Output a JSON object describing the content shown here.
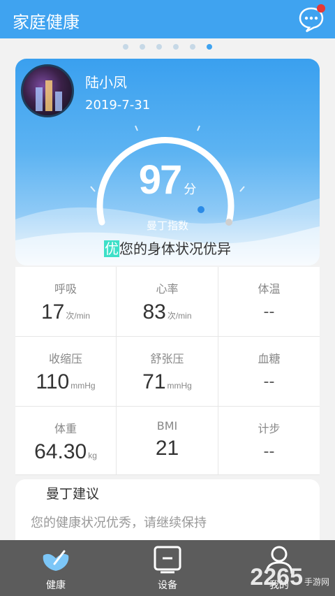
{
  "header": {
    "title": "家庭健康",
    "chat_icon": "chat-bubble-icon"
  },
  "carousel": {
    "count": 6,
    "active_index": 5
  },
  "profile": {
    "name": "陆小凤",
    "date": "2019-7-31",
    "icons": [
      "share-icon",
      "mail-icon",
      "warning-icon"
    ]
  },
  "score": {
    "value": "97",
    "unit": "分",
    "label": "曼丁指数",
    "grade": "优",
    "status_text": "您的身体状况优异"
  },
  "metrics": [
    {
      "label": "呼吸",
      "value": "17",
      "unit": "次/min"
    },
    {
      "label": "心率",
      "value": "83",
      "unit": "次/min"
    },
    {
      "label": "体温",
      "value": "--",
      "unit": ""
    },
    {
      "label": "收缩压",
      "value": "110",
      "unit": "mmHg"
    },
    {
      "label": "舒张压",
      "value": "71",
      "unit": "mmHg"
    },
    {
      "label": "血糖",
      "value": "--",
      "unit": ""
    },
    {
      "label": "体重",
      "value": "64.30",
      "unit": "kg"
    },
    {
      "label": "BMI",
      "value": "21",
      "unit": ""
    },
    {
      "label": "计步",
      "value": "--",
      "unit": ""
    }
  ],
  "advice": {
    "heading": "曼丁建议",
    "text": "您的健康状况优秀，请继续保持"
  },
  "nav": [
    {
      "label": "健康",
      "icon": "heart-hand-icon"
    },
    {
      "label": "设备",
      "icon": "device-icon"
    },
    {
      "label": "我的",
      "icon": "user-icon"
    }
  ],
  "watermark": {
    "main": "2265",
    "sub": "手游网"
  },
  "colors": {
    "primary": "#3fa3f0",
    "grade_highlight": "#3de0c8",
    "notification": "#e53935",
    "navbar": "#5c5c5c"
  }
}
